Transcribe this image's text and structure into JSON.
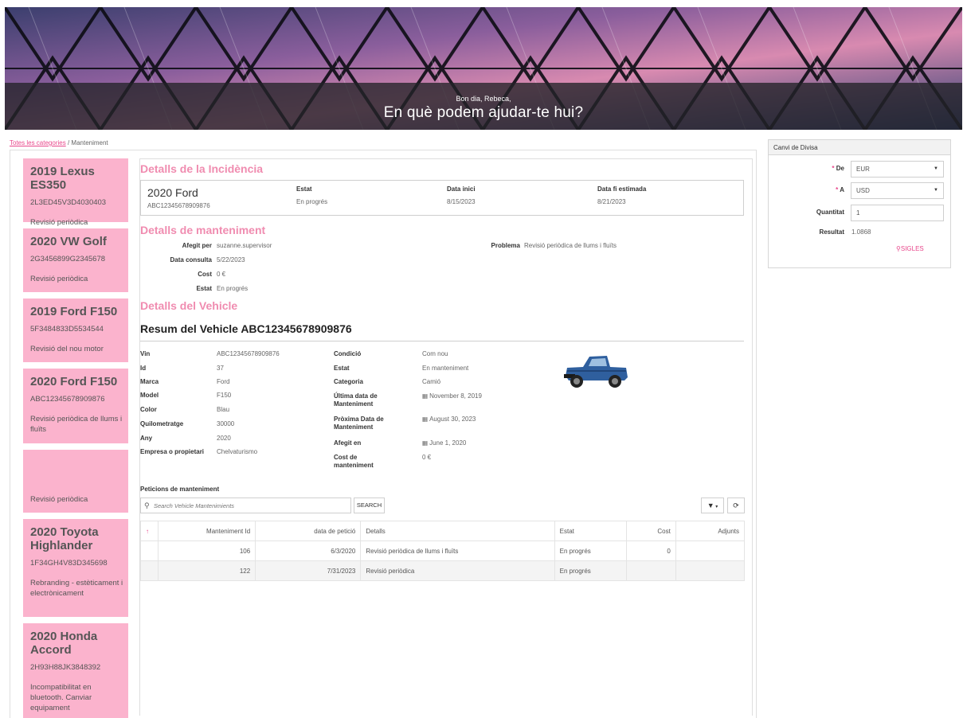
{
  "banner": {
    "greeting": "Bon dia, Rebeca,",
    "headline": "En què podem ajudar-te hui?"
  },
  "breadcrumb": {
    "root": "Totes les categories",
    "separator": "/",
    "current": "Manteniment"
  },
  "vehicles": [
    {
      "title": "2019 Lexus ES350",
      "vin": "2L3ED45V3D4030403",
      "desc": "Revisió periòdica"
    },
    {
      "title": "2020 VW Golf",
      "vin": "2G3456899G2345678",
      "desc": "Revisió periòdica"
    },
    {
      "title": "2019 Ford F150",
      "vin": "5F3484833D5534544",
      "desc": "Revisió del nou motor"
    },
    {
      "title": "2020 Ford F150",
      "vin": "ABC12345678909876",
      "desc": "Revisió periòdica de llums i fluïts"
    },
    {
      "title": "",
      "vin": "",
      "desc": "Revisió periòdica"
    },
    {
      "title": "2020 Toyota Highlander",
      "vin": "1F34GH4V83D345698",
      "desc": "Rebranding - estèticament i electrònicament"
    },
    {
      "title": "2020 Honda Accord",
      "vin": "2H93H88JK3848392",
      "desc": "Incompatibilitat en bluetooth. Canviar equipament"
    }
  ],
  "incident": {
    "section_title": "Detalls de la Incidència",
    "vehicle_title": "2020 Ford",
    "vin": "ABC12345678909876",
    "status_label": "Estat",
    "status_value": "En progrés",
    "start_label": "Data inici",
    "start_value": "8/15/2023",
    "end_label": "Data fi estimada",
    "end_value": "8/21/2023"
  },
  "maintenance": {
    "section_title": "Detalls de manteniment",
    "added_by_label": "Afegit per",
    "added_by_value": "suzanne.supervisor",
    "consult_label": "Data consulta",
    "consult_value": "5/22/2023",
    "cost_label": "Cost",
    "cost_value": "0 €",
    "status_label": "Estat",
    "status_value": "En progrés",
    "problem_label": "Problema",
    "problem_value": "Revisió periòdica de llums i fluïts"
  },
  "vehicle_details": {
    "section_title": "Detalls del Vehicle",
    "summary_title": "Resum del Vehicle ABC12345678909876",
    "left": [
      {
        "label": "Vin",
        "value": "ABC12345678909876"
      },
      {
        "label": "Id",
        "value": "37"
      },
      {
        "label": "Marca",
        "value": "Ford"
      },
      {
        "label": "Model",
        "value": "F150"
      },
      {
        "label": "Color",
        "value": "Blau"
      },
      {
        "label": "Quilometratge",
        "value": "30000"
      },
      {
        "label": "Any",
        "value": "2020"
      },
      {
        "label": "Empresa o propietari",
        "value": "Chelvaturismo"
      }
    ],
    "right": [
      {
        "label": "Condició",
        "value": "Com nou"
      },
      {
        "label": "Estat",
        "value": "En manteniment"
      },
      {
        "label": "Categoria",
        "value": "Camió"
      },
      {
        "label": "Última data de Manteniment",
        "value": "November 8, 2019"
      },
      {
        "label": "Pròxima Data de Manteniment",
        "value": "August 30, 2023"
      },
      {
        "label": "Afegit en",
        "value": "June 1, 2020"
      },
      {
        "label": "Cost de manteniment",
        "value": "0 €"
      }
    ]
  },
  "requests": {
    "title": "Peticions de manteniment",
    "search_placeholder": "Search Vehicle Mantenimients",
    "search_button": "SEARCH",
    "filter_icon": "filter-icon",
    "refresh_icon": "refresh-icon",
    "columns": [
      "Manteniment Id",
      "data de petició",
      "Detalls",
      "Estat",
      "Cost",
      "Adjunts"
    ],
    "rows": [
      {
        "id": "106",
        "date": "6/3/2020",
        "details": "Revisió periòdica de llums i fluïts",
        "status": "En progrés",
        "cost": "0",
        "attachments": ""
      },
      {
        "id": "122",
        "date": "7/31/2023",
        "details": "Revisió periòdica",
        "status": "En progrés",
        "cost": "",
        "attachments": ""
      }
    ]
  },
  "currency": {
    "title": "Canvi de Divisa",
    "from_label": "De",
    "from_value": "EUR",
    "to_label": "A",
    "to_value": "USD",
    "amount_label": "Quantitat",
    "amount_value": "1",
    "result_label": "Resultat",
    "result_value": "1.0868",
    "sigles_button": "SIGLES"
  },
  "colors": {
    "accent_pink": "#f08cb0",
    "card_pink": "#fbb3cd",
    "link_pink": "#e8478b"
  }
}
